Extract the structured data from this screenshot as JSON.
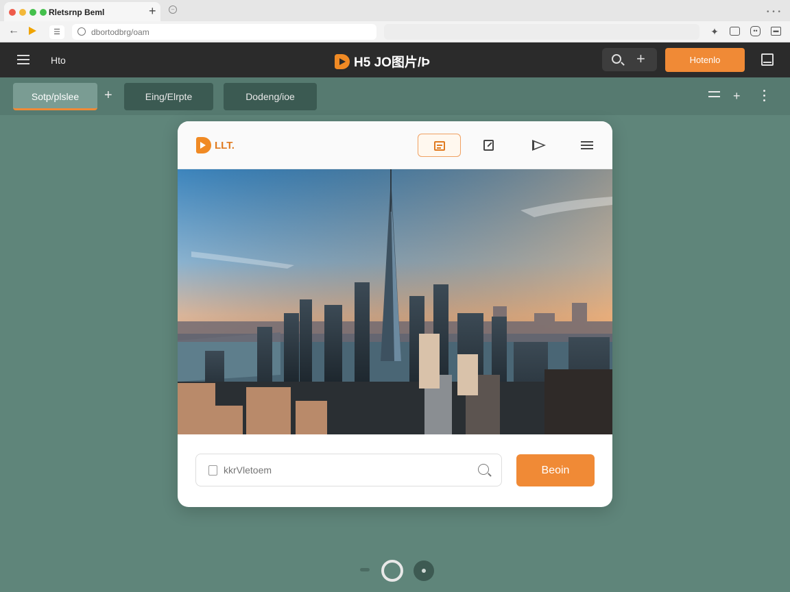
{
  "browser": {
    "tab_title": "Rletsrnp Beml",
    "new_tab_label": "+",
    "url": "dbortodbrg/oam",
    "window_menu": "• • •"
  },
  "header": {
    "left_label": "Hto",
    "brand_text": "H5 JO图片/Þ",
    "primary_button": "Hotenlo",
    "plus_label": "+"
  },
  "toolbar": {
    "tabs": [
      {
        "label": "Sotp/plslee",
        "active": true
      },
      {
        "label": "Eing/Elrpte",
        "active": false
      },
      {
        "label": "Dodeng/ioe",
        "active": false
      }
    ],
    "plus_label": "+",
    "right_plus_label": "+"
  },
  "card": {
    "logo_text": "LLT.",
    "search_placeholder": "kkrVletoem",
    "search_button": "Beoin"
  },
  "colors": {
    "accent": "#f08a36",
    "background": "#5f857a",
    "header": "#2b2b2b"
  }
}
